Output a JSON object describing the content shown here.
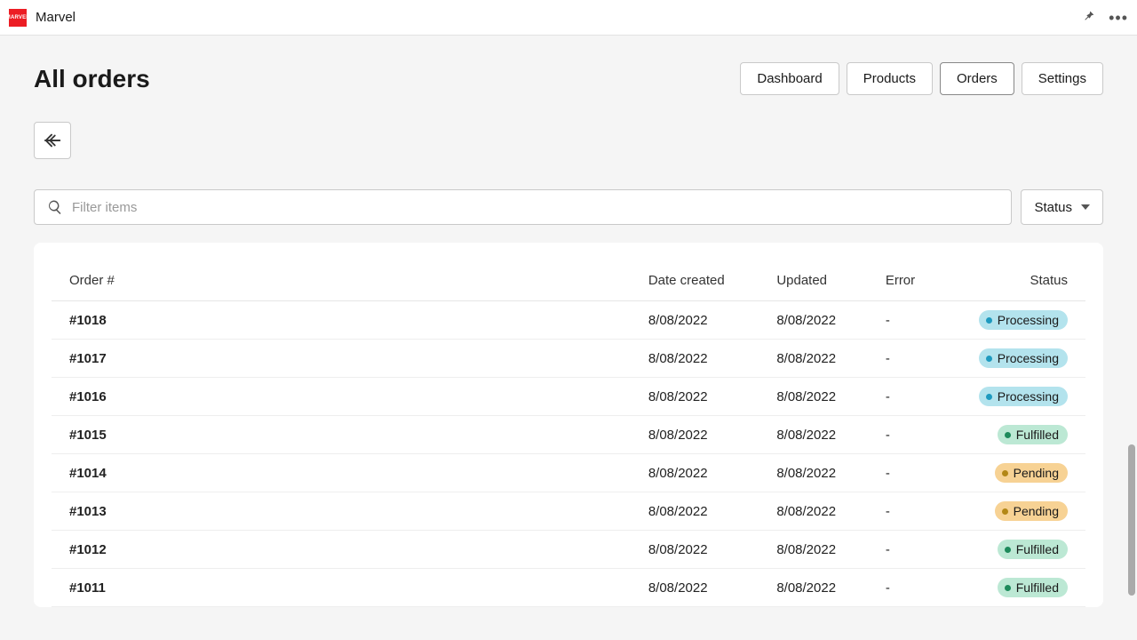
{
  "topbar": {
    "brand_text": "MARVEL",
    "title": "Marvel"
  },
  "header": {
    "page_title": "All orders",
    "nav": {
      "dashboard": "Dashboard",
      "products": "Products",
      "orders": "Orders",
      "settings": "Settings"
    }
  },
  "filter": {
    "placeholder": "Filter items",
    "status_label": "Status"
  },
  "table": {
    "columns": {
      "order": "Order #",
      "created": "Date created",
      "updated": "Updated",
      "error": "Error",
      "status": "Status"
    },
    "rows": [
      {
        "order": "#1018",
        "created": "8/08/2022",
        "updated": "8/08/2022",
        "error": "-",
        "status_label": "Processing",
        "status_class": "processing"
      },
      {
        "order": "#1017",
        "created": "8/08/2022",
        "updated": "8/08/2022",
        "error": "-",
        "status_label": "Processing",
        "status_class": "processing"
      },
      {
        "order": "#1016",
        "created": "8/08/2022",
        "updated": "8/08/2022",
        "error": "-",
        "status_label": "Processing",
        "status_class": "processing"
      },
      {
        "order": "#1015",
        "created": "8/08/2022",
        "updated": "8/08/2022",
        "error": "-",
        "status_label": "Fulfilled",
        "status_class": "fulfilled"
      },
      {
        "order": "#1014",
        "created": "8/08/2022",
        "updated": "8/08/2022",
        "error": "-",
        "status_label": "Pending",
        "status_class": "pending"
      },
      {
        "order": "#1013",
        "created": "8/08/2022",
        "updated": "8/08/2022",
        "error": "-",
        "status_label": "Pending",
        "status_class": "pending"
      },
      {
        "order": "#1012",
        "created": "8/08/2022",
        "updated": "8/08/2022",
        "error": "-",
        "status_label": "Fulfilled",
        "status_class": "fulfilled"
      },
      {
        "order": "#1011",
        "created": "8/08/2022",
        "updated": "8/08/2022",
        "error": "-",
        "status_label": "Fulfilled",
        "status_class": "fulfilled"
      }
    ]
  }
}
